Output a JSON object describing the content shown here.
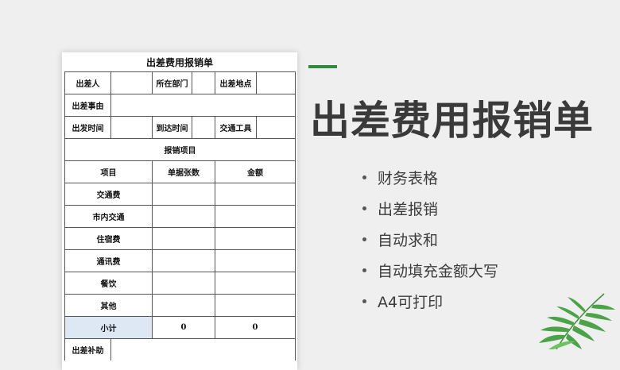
{
  "form": {
    "title": "出差费用报销单",
    "traveler_label": "出差人",
    "department_label": "所在部门",
    "location_label": "出差地点",
    "reason_label": "出差事由",
    "depart_time_label": "出发时间",
    "arrive_time_label": "到达时间",
    "transport_label": "交通工具",
    "items_section_label": "报销项目",
    "col_item": "项目",
    "col_receipts": "单据张数",
    "col_amount": "金额",
    "items": [
      "交通费",
      "市内交通",
      "住宿费",
      "通讯费",
      "餐饮",
      "其他"
    ],
    "subtotal_label": "小计",
    "subtotal_receipts": "0",
    "subtotal_amount": "0",
    "allowance_label": "出差补助"
  },
  "promo": {
    "title": "出差费用报销单",
    "features": [
      "财务表格",
      "出差报销",
      "自动求和",
      "自动填充金额大写",
      "A4可打印"
    ],
    "accent_color": "#2e8b3e"
  }
}
